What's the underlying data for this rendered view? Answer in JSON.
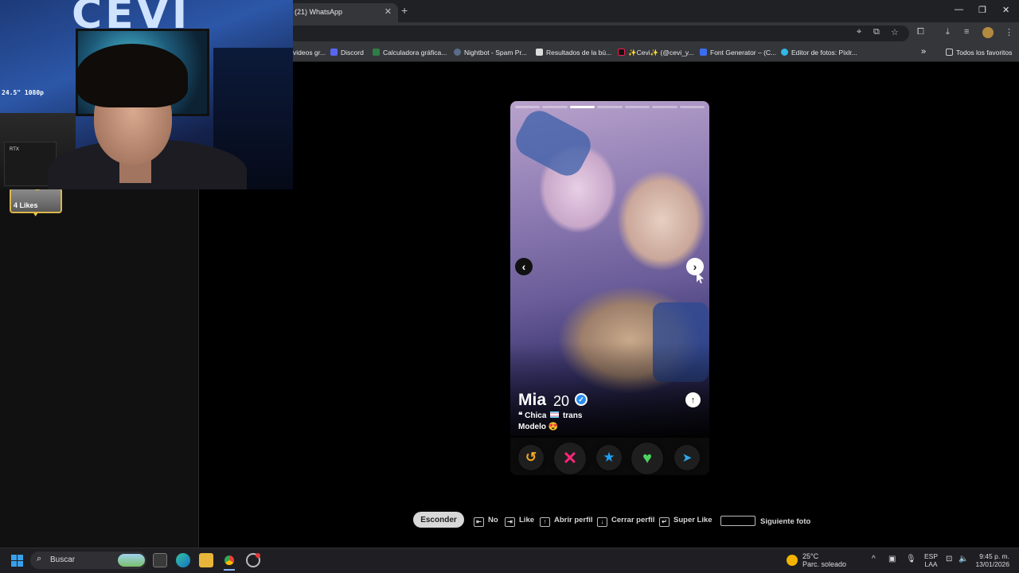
{
  "browser": {
    "active_tab_title": "(21) WhatsApp",
    "bookmarks": [
      {
        "label": "videos gr..."
      },
      {
        "label": "Discord"
      },
      {
        "label": "Calculadora gráfica..."
      },
      {
        "label": "Nightbot - Spam Pr..."
      },
      {
        "label": "Resultados de la bú..."
      },
      {
        "label": "✨Cevi✨ (@cevi_y..."
      },
      {
        "label": "Font Generator – (C..."
      },
      {
        "label": "Editor de fotos: Pixlr..."
      }
    ],
    "all_favorites": "Todos los favoritos",
    "more_bookmarks_glyph": "»"
  },
  "webcam": {
    "wall_logo": "CEVI",
    "monitor_label": "24.5\" 1080p",
    "gpu_box_label": "RTX"
  },
  "sidebar": {
    "likes_label": "4 Likes"
  },
  "profile": {
    "name": "Mia",
    "age": "20",
    "verified_glyph": "✓",
    "line1_prefix": "❝ Chica",
    "line1_suffix": "trans",
    "line2": "Modelo 😍",
    "photo_count": 7,
    "active_photo_index": 2
  },
  "actions": {
    "rewind": "↺",
    "nope": "✕",
    "super_like": "★",
    "like": "♥",
    "boost": "➤"
  },
  "shortcuts": {
    "hide": "Esconder",
    "no": "No",
    "like": "Like",
    "open_profile": "Abrir perfil",
    "close_profile": "Cerrar perfil",
    "super_like": "Super Like",
    "next_photo": "Siguiente foto"
  },
  "taskbar": {
    "search_placeholder": "Buscar",
    "weather_temp": "25°C",
    "weather_desc": "Parc. soleado",
    "lang_top": "ESP",
    "lang_bottom": "LAA",
    "time": "9:45 p. m.",
    "date": "13/01/2026"
  },
  "colors": {
    "nope": "#fd267a",
    "like": "#4ed15f",
    "super_like": "#1ea0f2",
    "rewind": "#f5a623",
    "verified": "#2a8df3"
  }
}
